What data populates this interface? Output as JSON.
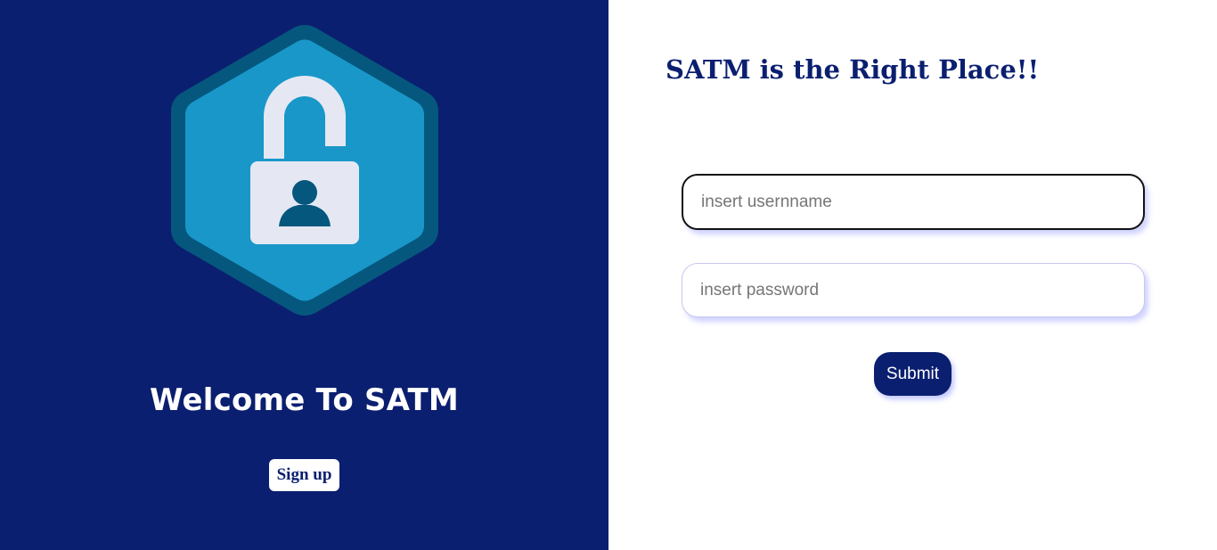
{
  "left_panel": {
    "logo_icon": "unlocked-padlock-user-hexagon-icon",
    "welcome_title": "Welcome To SATM",
    "signup_label": "Sign up"
  },
  "right_panel": {
    "tagline": "SATM is the Right Place!!",
    "username": {
      "value": "",
      "placeholder": "insert usernname"
    },
    "password": {
      "value": "",
      "placeholder": "insert password"
    },
    "submit_label": "Submit"
  },
  "colors": {
    "brand_navy": "#0b1f70",
    "hex_outer": "#05577e",
    "hex_inner": "#1997c9",
    "lock_body": "#e5e8f2",
    "white": "#ffffff"
  }
}
